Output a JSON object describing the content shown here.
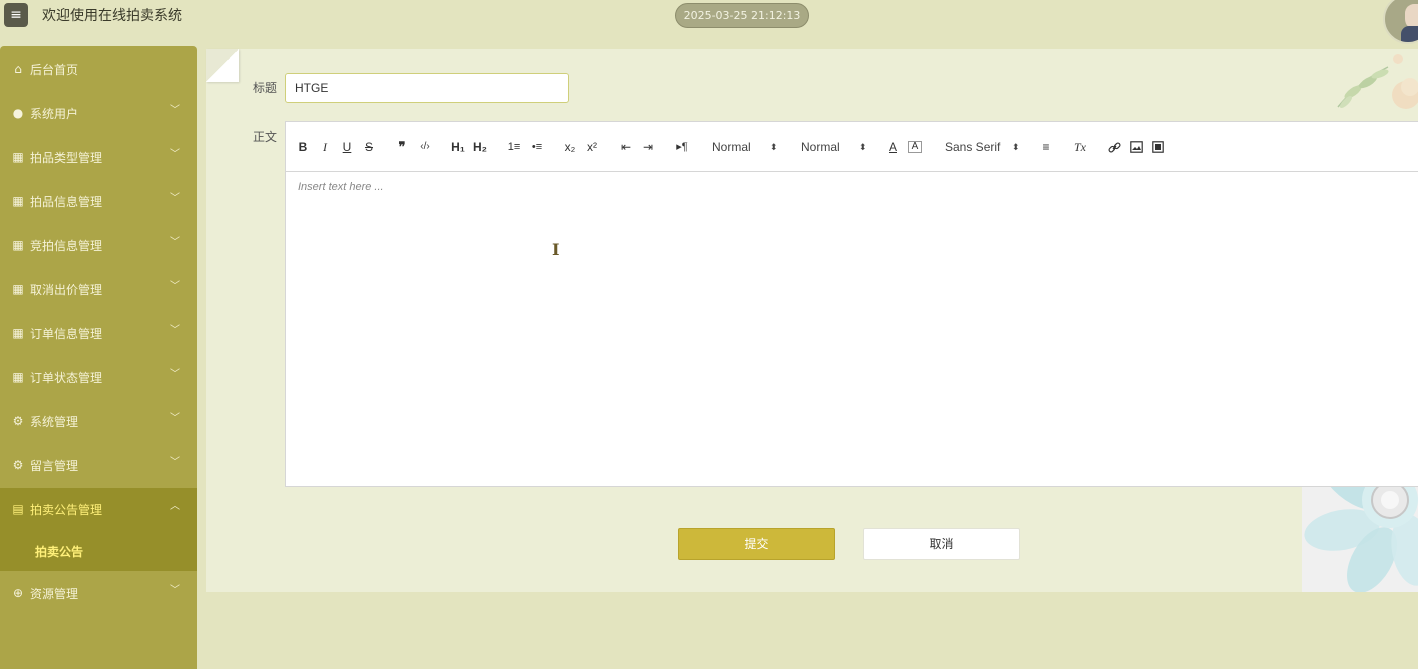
{
  "header": {
    "menu_icon": "hamburger-icon",
    "app_title": "欢迎使用在线拍卖系统",
    "datetime": "2025-03-25 21:12:13"
  },
  "sidebar": {
    "accent_color": "#aca548",
    "active_color": "#968f2a",
    "items": [
      {
        "label": "后台首页",
        "icon": "home-icon"
      },
      {
        "label": "系统用户",
        "icon": "user-icon"
      },
      {
        "label": "拍品类型管理",
        "icon": "dashboard-icon"
      },
      {
        "label": "拍品信息管理",
        "icon": "dashboard-icon"
      },
      {
        "label": "竞拍信息管理",
        "icon": "dashboard-icon"
      },
      {
        "label": "取消出价管理",
        "icon": "dashboard-icon"
      },
      {
        "label": "订单信息管理",
        "icon": "dashboard-icon"
      },
      {
        "label": "订单状态管理",
        "icon": "dashboard-icon"
      },
      {
        "label": "系统管理",
        "icon": "gear-icon"
      },
      {
        "label": "留言管理",
        "icon": "gear-icon"
      },
      {
        "label": "拍卖公告管理",
        "icon": "document-icon"
      },
      {
        "label": "资源管理",
        "icon": "plus-circle-icon"
      }
    ],
    "submenu": {
      "label": "拍卖公告"
    }
  },
  "form": {
    "title_label": "标题",
    "title_value": "HTGE",
    "body_label": "正文",
    "editor": {
      "placeholder": "Insert text here ...",
      "toolbar": {
        "bold": "B",
        "italic": "I",
        "underline": "U",
        "strike": "S",
        "blockquote": "❞",
        "code": "‹/›",
        "h1": "H₁",
        "h2": "H₂",
        "ordered_list": "1≡",
        "bullet_list": "•≡",
        "subscript": "x₂",
        "superscript": "x²",
        "outdent": "⇤",
        "indent": "⇥",
        "direction": "▸¶",
        "size_value": "Normal",
        "header_value": "Normal",
        "color_icon": "A",
        "background_icon": "A",
        "font_value": "Sans Serif",
        "align_icon": "≡",
        "clean_icon": "Tx",
        "link_icon": "link-icon",
        "image_icon": "image-icon",
        "video_icon": "video-icon"
      }
    },
    "submit_label": "提交",
    "cancel_label": "取消",
    "submit_color": "#cdb83a"
  }
}
